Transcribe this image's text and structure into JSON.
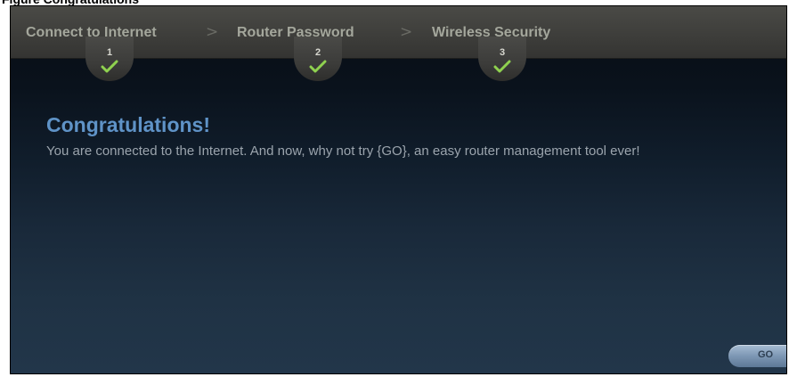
{
  "wizard": {
    "steps": [
      {
        "label": "Connect to Internet",
        "number": "1"
      },
      {
        "label": "Router Password",
        "number": "2"
      },
      {
        "label": "Wireless Security",
        "number": "3"
      }
    ],
    "separator_glyph": ">"
  },
  "content": {
    "headline": "Congratulations!",
    "message": "You are connected to the Internet. And now, why not try {GO}, an easy router management tool ever!"
  },
  "go_button": {
    "label": "GO"
  },
  "colors": {
    "headline": "#5f93c7",
    "step_label": "#a4a79c",
    "check": "#8fd14f",
    "button": "#7d97b4"
  }
}
